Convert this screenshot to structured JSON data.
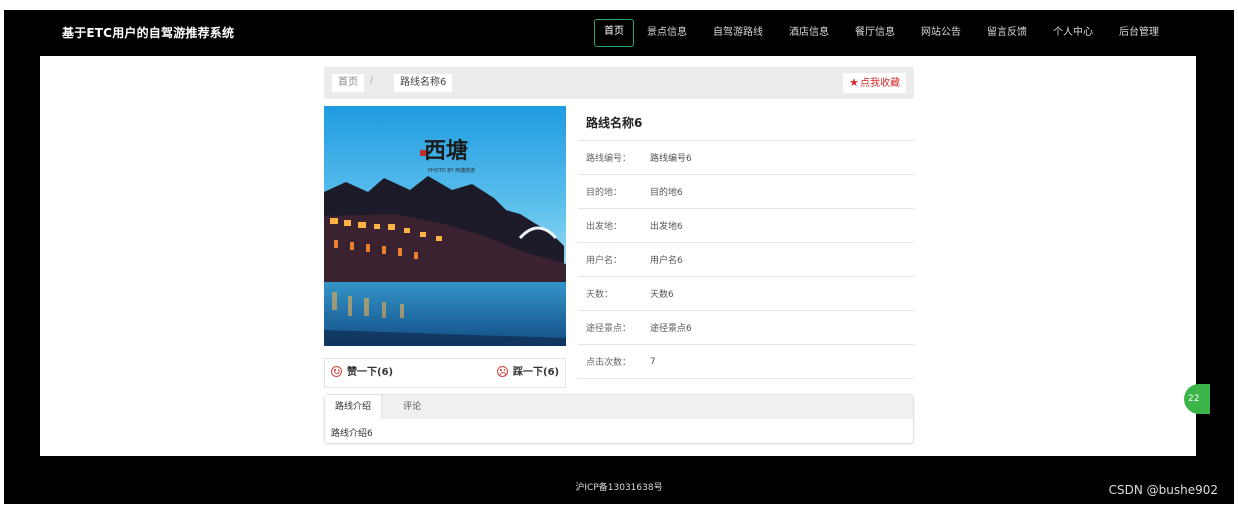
{
  "site": {
    "title": "基于ETC用户的自驾游推荐系统"
  },
  "nav": [
    "首页",
    "景点信息",
    "自驾游路线",
    "酒店信息",
    "餐厅信息",
    "网站公告",
    "留言反馈",
    "个人中心",
    "后台管理"
  ],
  "breadcrumb": {
    "home": "首页",
    "separator": "/",
    "current": "路线名称6"
  },
  "favorite": {
    "label": "点我收藏"
  },
  "route": {
    "title": "路线名称6",
    "fields": [
      {
        "label": "路线编号：",
        "value": "路线编号6"
      },
      {
        "label": "目的地：",
        "value": "目的地6"
      },
      {
        "label": "出发地：",
        "value": "出发地6"
      },
      {
        "label": "用户名：",
        "value": "用户名6"
      },
      {
        "label": "天数：",
        "value": "天数6"
      },
      {
        "label": "途径景点：",
        "value": "途径景点6"
      },
      {
        "label": "点击次数：",
        "value": "7"
      }
    ]
  },
  "photo": {
    "calligraphy": "西塘",
    "caption": "PHOTO BY 西塘旅游"
  },
  "votes": {
    "up": "赞一下(6)",
    "down": "踩一下(6)"
  },
  "tabs": {
    "items": [
      "路线介绍",
      "评论"
    ],
    "content": "路线介绍6"
  },
  "footer": {
    "icp": "沪ICP备13031638号"
  },
  "float_badge": "22",
  "watermark": "CSDN @bushe902",
  "colors": {
    "accent": "#2aa578",
    "favorite": "#d42a2a",
    "badge": "#3cb548"
  }
}
